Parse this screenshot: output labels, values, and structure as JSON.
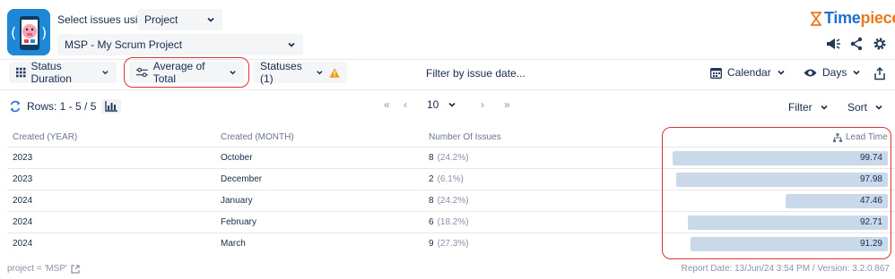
{
  "header": {
    "select_label": "Select issues using",
    "source_select": "Project",
    "project_select": "MSP - My Scrum Project",
    "brand_name_part1": "Time",
    "brand_name_part2": "piece"
  },
  "toolbar": {
    "status_duration": "Status Duration",
    "average": "Average of Total",
    "statuses": "Statuses (1)",
    "filter_date": "Filter by issue date...",
    "calendar": "Calendar",
    "days": "Days"
  },
  "pagination": {
    "rows_label": "Rows: 1 - 5 / 5",
    "page_size": "10",
    "filter": "Filter",
    "sort": "Sort"
  },
  "table": {
    "headers": [
      "Created (YEAR)",
      "Created (MONTH)",
      "Number Of Issues",
      "Lead Time"
    ],
    "rows": [
      {
        "year": "2023",
        "month": "October",
        "issues": "8",
        "pct": "(24.2%)",
        "lead": "99.74",
        "lead_value": 99.74
      },
      {
        "year": "2023",
        "month": "December",
        "issues": "2",
        "pct": "(6.1%)",
        "lead": "97.98",
        "lead_value": 97.98
      },
      {
        "year": "2024",
        "month": "January",
        "issues": "8",
        "pct": "(24.2%)",
        "lead": "47.46",
        "lead_value": 47.46
      },
      {
        "year": "2024",
        "month": "February",
        "issues": "6",
        "pct": "(18.2%)",
        "lead": "92.71",
        "lead_value": 92.71
      },
      {
        "year": "2024",
        "month": "March",
        "issues": "9",
        "pct": "(27.3%)",
        "lead": "91.29",
        "lead_value": 91.29
      }
    ]
  },
  "footer": {
    "query": "project = 'MSP'",
    "report": "Report Date: 13/Jun/24 3:54 PM / Version: 3.2.0.867"
  },
  "colors": {
    "accent_red": "#e0322c",
    "bar": "#c9d9ea",
    "brand_blue": "#1e6fd0",
    "brand_orange": "#e97a1c",
    "warning": "#f29b1e"
  }
}
